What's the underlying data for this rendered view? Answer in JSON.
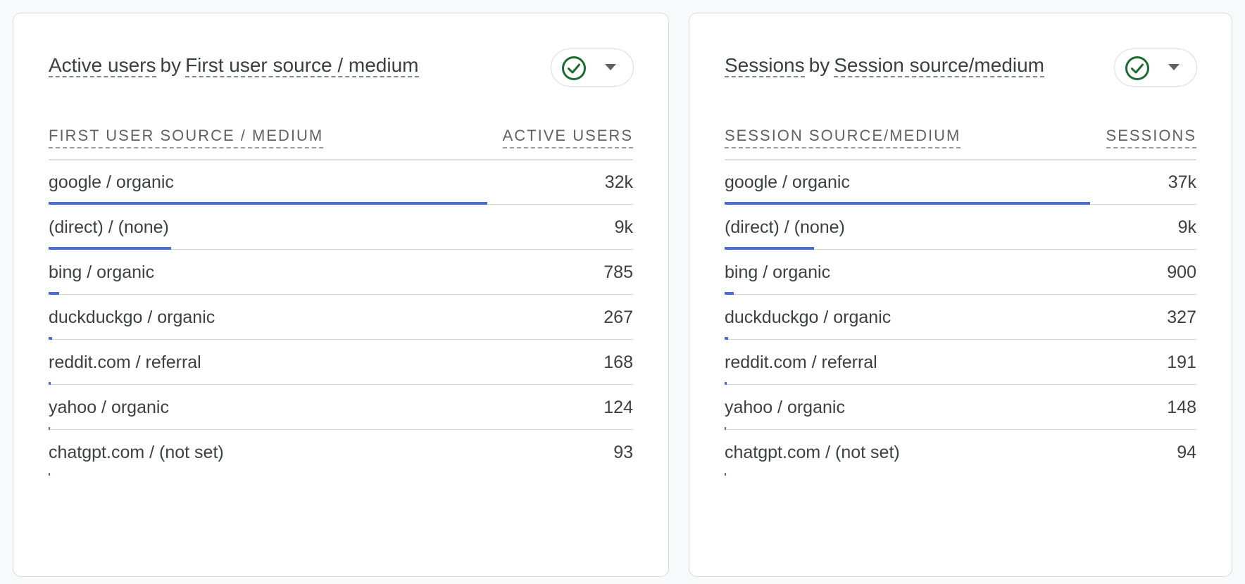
{
  "colors": {
    "bar": "#4a6ee0",
    "check": "#1e6b2e"
  },
  "cards": [
    {
      "title_metric": "Active users",
      "title_by": "by",
      "title_dimension": "First user source / medium",
      "col_dimension": "FIRST USER SOURCE / MEDIUM",
      "col_metric": "ACTIVE USERS",
      "menu_icons": [
        "check-circle-icon",
        "caret-down-icon"
      ],
      "rows": [
        {
          "label": "google / organic",
          "value": "32k",
          "fraction": 0.75
        },
        {
          "label": "(direct) / (none)",
          "value": "9k",
          "fraction": 0.21
        },
        {
          "label": "bing / organic",
          "value": "785",
          "fraction": 0.018
        },
        {
          "label": "duckduckgo / organic",
          "value": "267",
          "fraction": 0.006
        },
        {
          "label": "reddit.com / referral",
          "value": "168",
          "fraction": 0.004
        },
        {
          "label": "yahoo / organic",
          "value": "124",
          "fraction": 0.003
        },
        {
          "label": "chatgpt.com / (not set)",
          "value": "93",
          "fraction": 0.002
        }
      ]
    },
    {
      "title_metric": "Sessions",
      "title_by": "by",
      "title_dimension": "Session source/medium",
      "col_dimension": "SESSION SOURCE/MEDIUM",
      "col_metric": "SESSIONS",
      "menu_icons": [
        "check-circle-icon",
        "caret-down-icon"
      ],
      "rows": [
        {
          "label": "google / organic",
          "value": "37k",
          "fraction": 0.775
        },
        {
          "label": "(direct) / (none)",
          "value": "9k",
          "fraction": 0.19
        },
        {
          "label": "bing / organic",
          "value": "900",
          "fraction": 0.019
        },
        {
          "label": "duckduckgo / organic",
          "value": "327",
          "fraction": 0.007
        },
        {
          "label": "reddit.com / referral",
          "value": "191",
          "fraction": 0.004
        },
        {
          "label": "yahoo / organic",
          "value": "148",
          "fraction": 0.003
        },
        {
          "label": "chatgpt.com / (not set)",
          "value": "94",
          "fraction": 0.002
        }
      ]
    }
  ]
}
